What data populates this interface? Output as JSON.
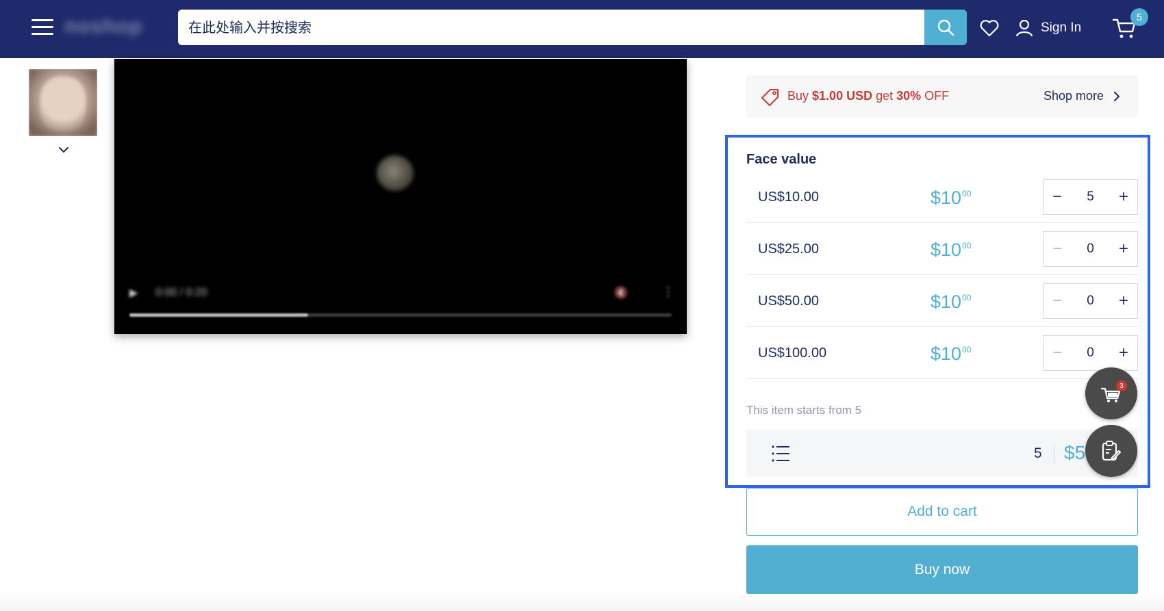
{
  "header": {
    "logo_text": "noshop",
    "search_placeholder": "在此处输入并按搜索",
    "sign_in_label": "Sign In",
    "cart_count": "5",
    "background_color": "#1e2a6b",
    "accent_color": "#4fb0d4",
    "icons": [
      "menu-icon",
      "search-icon",
      "heart-icon",
      "user-icon",
      "cart-icon"
    ]
  },
  "media": {
    "video_time": "0:00 / 0:20",
    "video_progress_fraction": 0.33,
    "icons": [
      "chevron-down-icon",
      "play-icon",
      "volume-icon",
      "more-vert-icon"
    ]
  },
  "promo": {
    "prefix": "Buy ",
    "amount": "$1.00 USD",
    "middle": " get ",
    "discount": "30%",
    "suffix": " OFF",
    "shop_more_label": "Shop more",
    "text_color": "#c53b33"
  },
  "face_value": {
    "title": "Face value",
    "rows": [
      {
        "label": "US$10.00",
        "price_main": "$10",
        "price_cents": "00",
        "minus": "−",
        "plus": "+",
        "quantity": "5"
      },
      {
        "label": "US$25.00",
        "price_main": "$10",
        "price_cents": "00",
        "minus": "−",
        "plus": "+",
        "quantity": "0"
      },
      {
        "label": "US$50.00",
        "price_main": "$10",
        "price_cents": "00",
        "minus": "−",
        "plus": "+",
        "quantity": "0"
      },
      {
        "label": "US$100.00",
        "price_main": "$10",
        "price_cents": "00",
        "minus": "−",
        "plus": "+",
        "quantity": "0"
      }
    ],
    "starts_from": "This item starts from 5",
    "summary_quantity": "5",
    "summary_total": "$50",
    "panel_highlight_color": "#2f63e8"
  },
  "floating": {
    "cart_badge": "3",
    "icons": [
      "floating-cart-icon",
      "clipboard-edit-icon"
    ]
  },
  "actions": {
    "add_to_cart_label": "Add to cart",
    "buy_now_label": "Buy now"
  }
}
